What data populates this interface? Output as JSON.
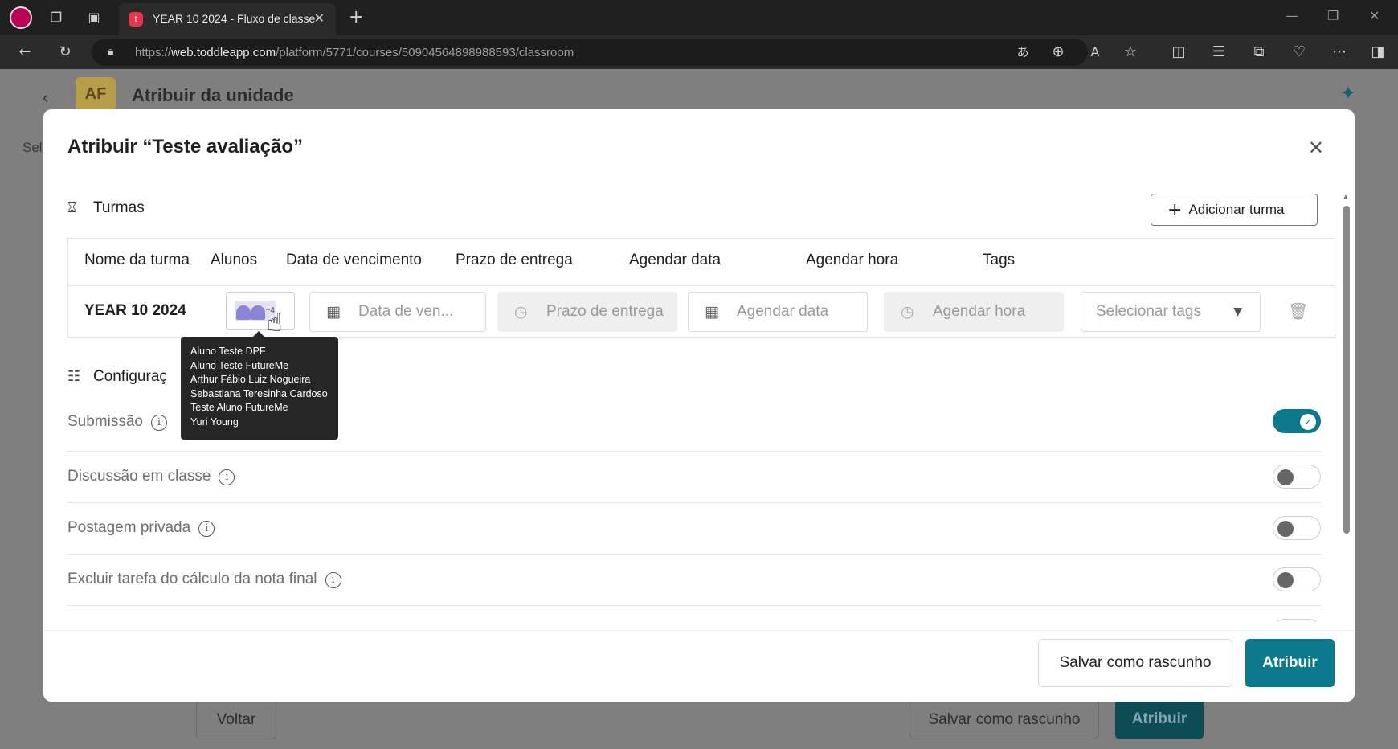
{
  "browser": {
    "tab_title": "YEAR 10 2024 - Fluxo de classe",
    "tab_favicon_letter": "t",
    "url_prefix": "https://",
    "url_domain": "web.toddleapp.com",
    "url_path": "/platform/5771/courses/50904564898988593/classroom"
  },
  "background_page": {
    "avatar_initials": "AF",
    "title": "Atribuir da unidade",
    "select_fragment": "Sel",
    "back_label": "Voltar",
    "draft_label": "Salvar como rascunho",
    "assign_label": "Atribuir"
  },
  "modal": {
    "title": "Atribuir “Teste avaliação”",
    "classes_section": {
      "heading": "Turmas",
      "add_button": "Adicionar turma",
      "columns": [
        "Nome da turma",
        "Alunos",
        "Data de vencimento",
        "Prazo de entrega",
        "Agendar data",
        "Agendar hora",
        "Tags"
      ],
      "row": {
        "name": "YEAR 10 2024",
        "students_extra": "+4",
        "due_date_placeholder": "Data de ven...",
        "deadline_placeholder": "Prazo de entrega",
        "schedule_date_placeholder": "Agendar data",
        "schedule_time_placeholder": "Agendar hora",
        "tags_placeholder": "Selecionar tags"
      }
    },
    "students_tooltip": [
      "Aluno Teste DPF",
      "Aluno Teste FutureMe",
      "Arthur Fábio Luiz Nogueira",
      "Sebastiana Teresinha Cardoso",
      "Teste Aluno FutureMe",
      "Yuri Young"
    ],
    "settings_section": {
      "heading": "Configuraç",
      "items": [
        {
          "label": "Submissão",
          "enabled": true
        },
        {
          "label": "Discussão em classe",
          "enabled": false
        },
        {
          "label": "Postagem privada",
          "enabled": false
        },
        {
          "label": "Excluir tarefa do cálculo da nota final",
          "enabled": false
        }
      ]
    },
    "footer": {
      "draft_label": "Salvar como rascunho",
      "assign_label": "Atribuir"
    }
  },
  "colors": {
    "accent": "#0b7a8c",
    "toggle_off_knob": "#666666"
  }
}
